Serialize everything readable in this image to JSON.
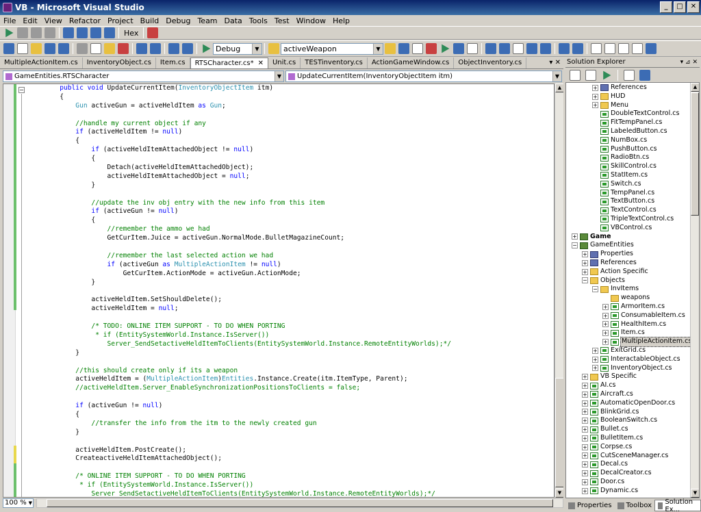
{
  "window": {
    "title": "VB - Microsoft Visual Studio",
    "min_label": "_",
    "max_label": "□",
    "close_label": "✕"
  },
  "menu": [
    "File",
    "Edit",
    "View",
    "Refactor",
    "Project",
    "Build",
    "Debug",
    "Team",
    "Data",
    "Tools",
    "Test",
    "Window",
    "Help"
  ],
  "toolbar": {
    "hex_label": "Hex",
    "config": "Debug",
    "find": "activeWeapon"
  },
  "tabs": [
    {
      "label": "MultipleActionItem.cs"
    },
    {
      "label": "InventoryObject.cs"
    },
    {
      "label": "Item.cs"
    },
    {
      "label": "RTSCharacter.cs*",
      "active": true
    },
    {
      "label": "Unit.cs"
    },
    {
      "label": "TESTinventory.cs"
    },
    {
      "label": "ActionGameWindow.cs"
    },
    {
      "label": "ObjectInventory.cs"
    }
  ],
  "tab_close": "✕",
  "tab_pin": "▾ ✕",
  "nav": {
    "class": "GameEntities.RTSCharacter",
    "member": "UpdateCurrentItem(InventoryObjectItem itm)"
  },
  "code_lines": [
    [
      [
        "kw",
        "        public void "
      ],
      [
        "t",
        "UpdateCurrentItem("
      ],
      [
        "ty",
        "InventoryObjectItem"
      ],
      [
        "t",
        " itm)"
      ]
    ],
    [
      [
        "t",
        "        {"
      ]
    ],
    [
      [
        "ty",
        "            Gun"
      ],
      [
        "t",
        " activeGun = activeHeldItem "
      ],
      [
        "kw",
        "as"
      ],
      [
        "ty",
        " Gun"
      ],
      [
        "t",
        ";"
      ]
    ],
    [
      [
        "t",
        ""
      ]
    ],
    [
      [
        "cm",
        "            //handle my current object if any"
      ]
    ],
    [
      [
        "kw",
        "            if"
      ],
      [
        "t",
        " (activeHeldItem != "
      ],
      [
        "kw",
        "null"
      ],
      [
        "t",
        ")"
      ]
    ],
    [
      [
        "t",
        "            {"
      ]
    ],
    [
      [
        "kw",
        "                if"
      ],
      [
        "t",
        " (activeHeldItemAttachedObject != "
      ],
      [
        "kw",
        "null"
      ],
      [
        "t",
        ")"
      ]
    ],
    [
      [
        "t",
        "                {"
      ]
    ],
    [
      [
        "t",
        "                    Detach(activeHeldItemAttachedObject);"
      ]
    ],
    [
      [
        "t",
        "                    activeHeldItemAttachedObject = "
      ],
      [
        "kw",
        "null"
      ],
      [
        "t",
        ";"
      ]
    ],
    [
      [
        "t",
        "                }"
      ]
    ],
    [
      [
        "t",
        ""
      ]
    ],
    [
      [
        "cm",
        "                //update the inv obj entry with the new info from this item"
      ]
    ],
    [
      [
        "kw",
        "                if"
      ],
      [
        "t",
        " (activeGun != "
      ],
      [
        "kw",
        "null"
      ],
      [
        "t",
        ")"
      ]
    ],
    [
      [
        "t",
        "                {"
      ]
    ],
    [
      [
        "cm",
        "                    //remember the ammo we had"
      ]
    ],
    [
      [
        "t",
        "                    GetCurItem.Juice = activeGun.NormalMode.BulletMagazineCount;"
      ]
    ],
    [
      [
        "t",
        ""
      ]
    ],
    [
      [
        "cm",
        "                    //remember the last selected action we had"
      ]
    ],
    [
      [
        "kw",
        "                    if"
      ],
      [
        "t",
        " (activeGun "
      ],
      [
        "kw",
        "as"
      ],
      [
        "ty",
        " MultipleActionItem"
      ],
      [
        "t",
        " != "
      ],
      [
        "kw",
        "null"
      ],
      [
        "t",
        ")"
      ]
    ],
    [
      [
        "t",
        "                        GetCurItem.ActionMode = activeGun.ActionMode;"
      ]
    ],
    [
      [
        "t",
        "                }"
      ]
    ],
    [
      [
        "t",
        ""
      ]
    ],
    [
      [
        "t",
        "                activeHeldItem.SetShouldDelete();"
      ]
    ],
    [
      [
        "t",
        "                activeHeldItem = "
      ],
      [
        "kw",
        "null"
      ],
      [
        "t",
        ";"
      ]
    ],
    [
      [
        "t",
        ""
      ]
    ],
    [
      [
        "cm",
        "                /* TODO: ONLINE ITEM SUPPORT - TO DO WHEN PORTING"
      ]
    ],
    [
      [
        "cm",
        "                 * if (EntitySystemWorld.Instance.IsServer())"
      ]
    ],
    [
      [
        "cm",
        "                    Server_SendSetactiveHeldItemToClients(EntitySystemWorld.Instance.RemoteEntityWorlds);*/"
      ]
    ],
    [
      [
        "t",
        "            }"
      ]
    ],
    [
      [
        "t",
        ""
      ]
    ],
    [
      [
        "cm",
        "            //this should create only if its a weapon"
      ]
    ],
    [
      [
        "t",
        "            activeHeldItem = ("
      ],
      [
        "ty",
        "MultipleActionItem"
      ],
      [
        "t",
        ")"
      ],
      [
        "ty",
        "Entities"
      ],
      [
        "t",
        ".Instance.Create(itm.ItemType, Parent);"
      ]
    ],
    [
      [
        "cm",
        "            //activeHeldItem.Server_EnableSynchronizationPositionsToClients = false;"
      ]
    ],
    [
      [
        "t",
        ""
      ]
    ],
    [
      [
        "kw",
        "            if"
      ],
      [
        "t",
        " (activeGun != "
      ],
      [
        "kw",
        "null"
      ],
      [
        "t",
        ")"
      ]
    ],
    [
      [
        "t",
        "            {"
      ]
    ],
    [
      [
        "cm",
        "                //transfer the info from the itm to the newly created gun"
      ]
    ],
    [
      [
        "t",
        "            }"
      ]
    ],
    [
      [
        "t",
        ""
      ]
    ],
    [
      [
        "t",
        "            activeHeldItem.PostCreate();"
      ]
    ],
    [
      [
        "t",
        "            CreateactiveHeldItemAttachedObject();"
      ]
    ],
    [
      [
        "t",
        ""
      ]
    ],
    [
      [
        "cm",
        "            /* ONLINE ITEM SUPPORT - TO DO WHEN PORTING"
      ]
    ],
    [
      [
        "cm",
        "             * if (EntitySystemWorld.Instance.IsServer())"
      ]
    ],
    [
      [
        "cm",
        "                Server_SendSetactiveHeldItemToClients(EntitySystemWorld.Instance.RemoteEntityWorlds);*/"
      ]
    ]
  ],
  "zoom": "100 %",
  "solution_explorer": {
    "title": "Solution Explorer",
    "title_buttons": "▾ ⊿ ✕",
    "items": [
      {
        "label": "References",
        "level": 2,
        "icon": "ref",
        "toggle": "+"
      },
      {
        "label": "HUD",
        "level": 2,
        "icon": "folder",
        "toggle": "+"
      },
      {
        "label": "Menu",
        "level": 2,
        "icon": "folder",
        "toggle": "+"
      },
      {
        "label": "DoubleTextControl.cs",
        "level": 2,
        "icon": "cs"
      },
      {
        "label": "FitTempPanel.cs",
        "level": 2,
        "icon": "cs"
      },
      {
        "label": "LabeledButton.cs",
        "level": 2,
        "icon": "cs"
      },
      {
        "label": "NumBox.cs",
        "level": 2,
        "icon": "cs"
      },
      {
        "label": "PushButton.cs",
        "level": 2,
        "icon": "cs"
      },
      {
        "label": "RadioBtn.cs",
        "level": 2,
        "icon": "cs"
      },
      {
        "label": "SkillControl.cs",
        "level": 2,
        "icon": "cs"
      },
      {
        "label": "StatItem.cs",
        "level": 2,
        "icon": "cs"
      },
      {
        "label": "Switch.cs",
        "level": 2,
        "icon": "cs"
      },
      {
        "label": "TempPanel.cs",
        "level": 2,
        "icon": "cs"
      },
      {
        "label": "TextButton.cs",
        "level": 2,
        "icon": "cs"
      },
      {
        "label": "TextControl.cs",
        "level": 2,
        "icon": "cs"
      },
      {
        "label": "TripleTextControl.cs",
        "level": 2,
        "icon": "cs"
      },
      {
        "label": "VBControl.cs",
        "level": 2,
        "icon": "cs"
      },
      {
        "label": "Game",
        "level": 0,
        "icon": "proj",
        "toggle": "+",
        "bold": true
      },
      {
        "label": "GameEntities",
        "level": 0,
        "icon": "proj",
        "toggle": "−"
      },
      {
        "label": "Properties",
        "level": 1,
        "icon": "ref",
        "toggle": "+"
      },
      {
        "label": "References",
        "level": 1,
        "icon": "ref",
        "toggle": "+"
      },
      {
        "label": "Action Specific",
        "level": 1,
        "icon": "folder",
        "toggle": "+"
      },
      {
        "label": "Objects",
        "level": 1,
        "icon": "folder",
        "toggle": "−"
      },
      {
        "label": "InvItems",
        "level": 2,
        "icon": "folder",
        "toggle": "−"
      },
      {
        "label": "weapons",
        "level": 3,
        "icon": "folder"
      },
      {
        "label": "ArmorItem.cs",
        "level": 3,
        "icon": "cs",
        "toggle": "+"
      },
      {
        "label": "ConsumableItem.cs",
        "level": 3,
        "icon": "cs",
        "toggle": "+"
      },
      {
        "label": "HealthItem.cs",
        "level": 3,
        "icon": "cs",
        "toggle": "+"
      },
      {
        "label": "Item.cs",
        "level": 3,
        "icon": "cs",
        "toggle": "+"
      },
      {
        "label": "MultipleActionItem.cs",
        "level": 3,
        "icon": "cs",
        "toggle": "+",
        "selected": true
      },
      {
        "label": "ExitGrid.cs",
        "level": 2,
        "icon": "cs",
        "toggle": "+"
      },
      {
        "label": "InteractableObject.cs",
        "level": 2,
        "icon": "cs",
        "toggle": "+"
      },
      {
        "label": "InventoryObject.cs",
        "level": 2,
        "icon": "cs",
        "toggle": "+"
      },
      {
        "label": "VB Specific",
        "level": 1,
        "icon": "folder",
        "toggle": "+"
      },
      {
        "label": "AI.cs",
        "level": 1,
        "icon": "cs",
        "toggle": "+"
      },
      {
        "label": "Aircraft.cs",
        "level": 1,
        "icon": "cs",
        "toggle": "+"
      },
      {
        "label": "AutomaticOpenDoor.cs",
        "level": 1,
        "icon": "cs",
        "toggle": "+"
      },
      {
        "label": "BlinkGrid.cs",
        "level": 1,
        "icon": "cs",
        "toggle": "+"
      },
      {
        "label": "BooleanSwitch.cs",
        "level": 1,
        "icon": "cs",
        "toggle": "+"
      },
      {
        "label": "Bullet.cs",
        "level": 1,
        "icon": "cs",
        "toggle": "+"
      },
      {
        "label": "BulletItem.cs",
        "level": 1,
        "icon": "cs",
        "toggle": "+"
      },
      {
        "label": "Corpse.cs",
        "level": 1,
        "icon": "cs",
        "toggle": "+"
      },
      {
        "label": "CutSceneManager.cs",
        "level": 1,
        "icon": "cs",
        "toggle": "+"
      },
      {
        "label": "Decal.cs",
        "level": 1,
        "icon": "cs",
        "toggle": "+"
      },
      {
        "label": "DecalCreator.cs",
        "level": 1,
        "icon": "cs",
        "toggle": "+"
      },
      {
        "label": "Door.cs",
        "level": 1,
        "icon": "cs",
        "toggle": "+"
      },
      {
        "label": "Dynamic.cs",
        "level": 1,
        "icon": "cs",
        "toggle": "+"
      }
    ]
  },
  "bottom_tabs": [
    {
      "label": "Properties"
    },
    {
      "label": "Toolbox"
    },
    {
      "label": "Solution Ex...",
      "active": true
    }
  ]
}
